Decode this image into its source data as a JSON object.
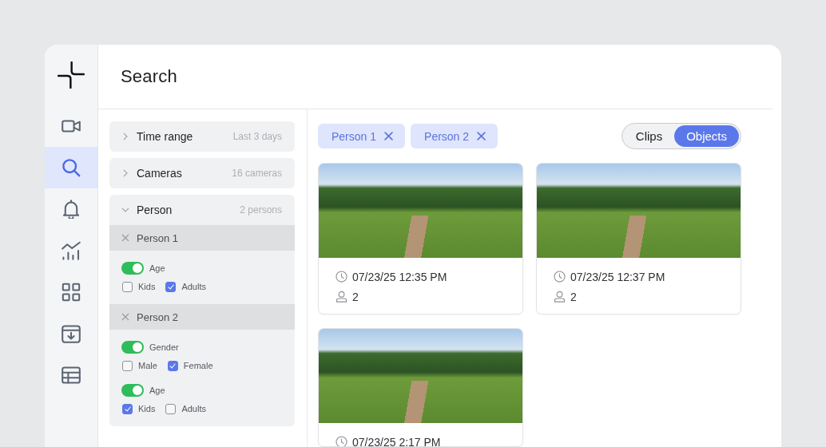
{
  "sidebar": {
    "items": [
      {
        "selected": false
      },
      {
        "selected": true
      },
      {
        "selected": false
      },
      {
        "selected": false
      },
      {
        "selected": false
      },
      {
        "selected": false
      },
      {
        "selected": false
      }
    ]
  },
  "header": {
    "title": "Search"
  },
  "filters": [
    {
      "label": "Time range",
      "summary": "Last 3 days",
      "expanded": false
    },
    {
      "label": "Cameras",
      "summary": "16 cameras",
      "expanded": false
    },
    {
      "label": "Person",
      "summary": "2 persons",
      "expanded": true,
      "persons": [
        {
          "label": "Person 1",
          "attributes": [
            {
              "label": "Age",
              "on": true,
              "options": [
                {
                  "label": "Kids",
                  "checked": false
                },
                {
                  "label": "Adults",
                  "checked": true
                }
              ]
            }
          ]
        },
        {
          "label": "Person 2",
          "attributes": [
            {
              "label": "Gender",
              "on": true,
              "options": [
                {
                  "label": "Male",
                  "checked": false
                },
                {
                  "label": "Female",
                  "checked": true
                }
              ]
            },
            {
              "label": "Age",
              "on": true,
              "options": [
                {
                  "label": "Kids",
                  "checked": true
                },
                {
                  "label": "Adults",
                  "checked": false
                }
              ]
            }
          ]
        }
      ]
    }
  ],
  "chips": [
    {
      "label": "Person 1"
    },
    {
      "label": "Person 2"
    }
  ],
  "view_toggle": [
    {
      "label": "Clips",
      "selected": false
    },
    {
      "label": "Objects",
      "selected": true
    }
  ],
  "results": [
    {
      "time": "07/23/25 12:35 PM",
      "count": "2"
    },
    {
      "time": "07/23/25 12:37 PM",
      "count": "2"
    },
    {
      "time": "07/23/25 2:17 PM"
    }
  ]
}
